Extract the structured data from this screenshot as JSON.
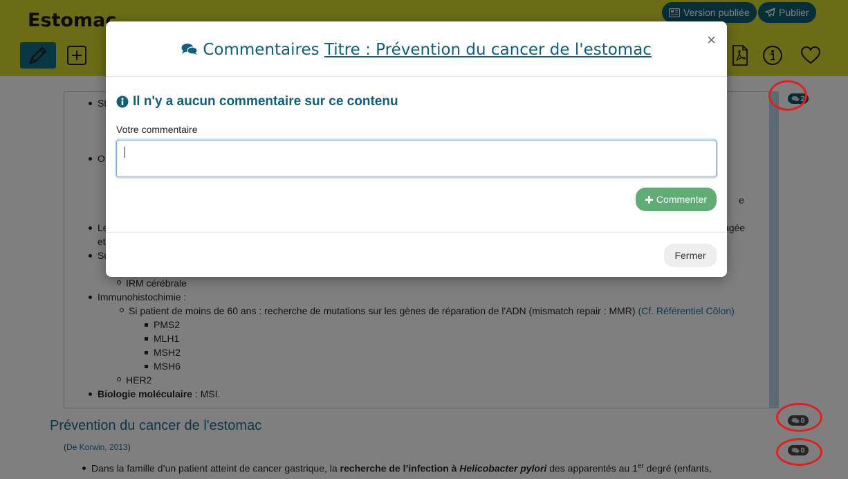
{
  "header": {
    "title": "Estomac",
    "version_label": "Version publiée",
    "publish_label": "Publier"
  },
  "content": {
    "partial_top": [
      "St",
      "O",
      "Le",
      "et",
      "Su"
    ],
    "partial_right": [
      "e",
      "agée"
    ],
    "item_irm": "IRM cérébrale",
    "item_immuno": "Immunohistochimie :",
    "item_mmr_text": "Si patient de moins de 60 ans : recherche de mutations sur les gènes de réparation de l'ADN (mismatch repair : MMR)",
    "item_mmr_link": "(Cf. Référentiel Côlon)",
    "genes": [
      "PMS2",
      "MLH1",
      "MSH2",
      "MSH6"
    ],
    "item_her2": "HER2",
    "item_bio_bold": "Biologie moléculaire",
    "item_bio_rest": " : MSI.",
    "section_title": "Prévention du cancer de l'estomac",
    "ref_open": "(",
    "ref_link": "De Korwin, 2013",
    "ref_close": ")",
    "last_a": "Dans la famille d’un patient atteint de cancer gastrique, la ",
    "last_b": "recherche de l’infection à ",
    "last_c": "Helicobacter pylori",
    "last_d": " des apparentés au 1",
    "last_sup": "er",
    "last_e": " degré (enfants,",
    "badges": [
      "2",
      "0",
      "0"
    ]
  },
  "modal": {
    "title_prefix": "Commentaires",
    "title_link": "Titre : Prévention du cancer de l'estomac",
    "empty_message": "Il n'y a aucun commentaire sur ce contenu",
    "field_label": "Votre commentaire",
    "textarea_value": "",
    "comment_label": "Commenter",
    "close_label": "Fermer",
    "close_symbol": "×"
  },
  "colors": {
    "header_bg": "#d5d92c",
    "accent": "#0d5e72",
    "modal_title": "#0f6078",
    "success": "#5fad74",
    "highlight_ring": "#e0201f"
  },
  "icons": [
    "pencil-icon",
    "plus-square-icon",
    "pdf-icon",
    "info-circle-icon",
    "heart-icon",
    "newspaper-icon",
    "paper-plane-icon",
    "comments-icon",
    "info-icon",
    "plus-icon"
  ]
}
